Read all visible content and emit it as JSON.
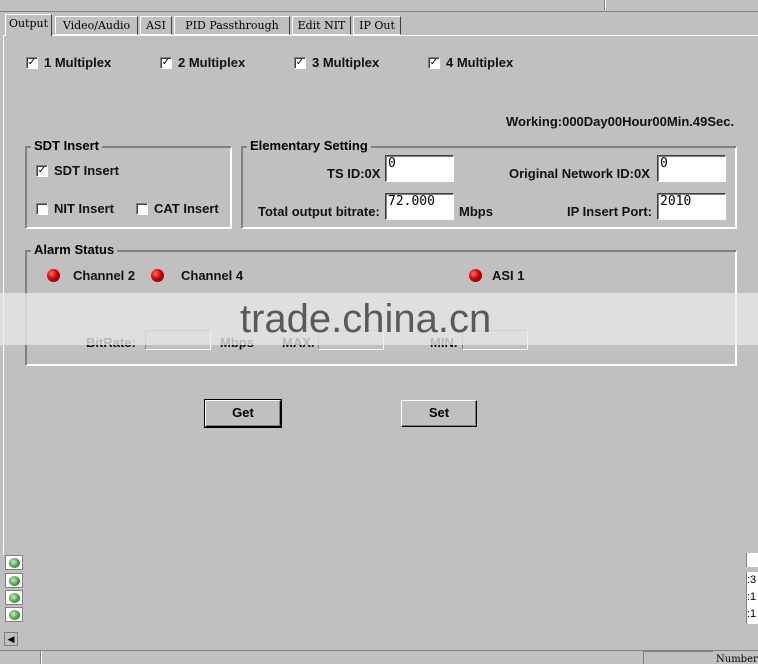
{
  "tabs": [
    {
      "label": "Output",
      "active": true
    },
    {
      "label": "Video/Audio",
      "active": false
    },
    {
      "label": "ASI",
      "active": false
    },
    {
      "label": "PID Passthrough",
      "active": false
    },
    {
      "label": "Edit NIT",
      "active": false
    },
    {
      "label": "IP Out",
      "active": false
    }
  ],
  "multiplex": [
    {
      "label": "1 Multiplex",
      "checked": true
    },
    {
      "label": "2 Multiplex",
      "checked": true
    },
    {
      "label": "3 Multiplex",
      "checked": true
    },
    {
      "label": "4 Multiplex",
      "checked": true
    }
  ],
  "working": "Working:000Day00Hour00Min.49Sec.",
  "sdt_group": {
    "title": "SDT Insert",
    "sdt_insert": {
      "label": "SDT Insert",
      "checked": true
    },
    "nit_insert": {
      "label": "NIT Insert",
      "checked": false
    },
    "cat_insert": {
      "label": "CAT Insert",
      "checked": false
    }
  },
  "elementary": {
    "title": "Elementary Setting",
    "ts_id_label": "TS ID:0X",
    "ts_id_value": "0",
    "onid_label": "Original Network ID:0X",
    "onid_value": "0",
    "bitrate_label": "Total output bitrate:",
    "bitrate_value": "72.000",
    "bitrate_unit": "Mbps",
    "ip_port_label": "IP Insert Port:",
    "ip_port_value": "2010"
  },
  "alarm": {
    "title": "Alarm Status",
    "channels": [
      "Channel 2",
      "Channel 4",
      "ASI 1"
    ],
    "bitrate_label": "BitRate:",
    "mbps_label": "Mbps",
    "max_label": "MAX.",
    "min_label": "MIN."
  },
  "buttons": {
    "get": "Get",
    "set": "Set"
  },
  "watermark": "trade.china.cn",
  "status": {
    "number_label": "Number"
  },
  "right_values": [
    ":3",
    ":1",
    ":1"
  ],
  "check_glyph": "✓",
  "colors": {
    "background": "#c0c0c0",
    "led": "#d40000"
  }
}
